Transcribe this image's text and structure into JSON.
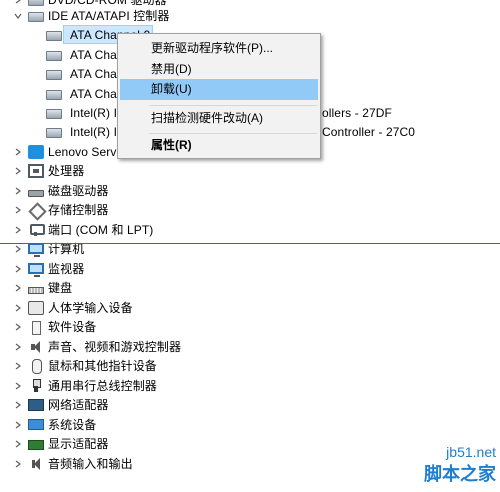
{
  "tree": {
    "top_partial_label": "DVD/CD-ROM 驱动器",
    "ide_category": "IDE ATA/ATAPI 控制器",
    "ide_children": [
      "ATA Channel 0",
      "ATA Cha",
      "ATA Cha",
      "ATA Cha",
      "Intel(R) I",
      "Intel(R) I"
    ],
    "child_tail_a": "ollers - 27DF",
    "child_tail_b": "Controller - 27C0",
    "categories": [
      "Lenovo Serv",
      "处理器",
      "磁盘驱动器",
      "存储控制器",
      "端口 (COM 和 LPT)",
      "计算机",
      "监视器",
      "键盘",
      "人体学输入设备",
      "软件设备",
      "声音、视频和游戏控制器",
      "鼠标和其他指针设备",
      "通用串行总线控制器",
      "网络适配器",
      "系统设备",
      "显示适配器",
      "音频输入和输出"
    ]
  },
  "context_menu": {
    "items": [
      "更新驱动程序软件(P)...",
      "禁用(D)",
      "卸载(U)",
      "扫描检测硬件改动(A)",
      "属性(R)"
    ]
  },
  "watermark": {
    "line1": "jb51.net",
    "line2": "脚本之家"
  },
  "colors": {
    "selection": "#cce8ff",
    "menu_hover": "#91c9f7",
    "annotation_line": "#c0392b"
  }
}
